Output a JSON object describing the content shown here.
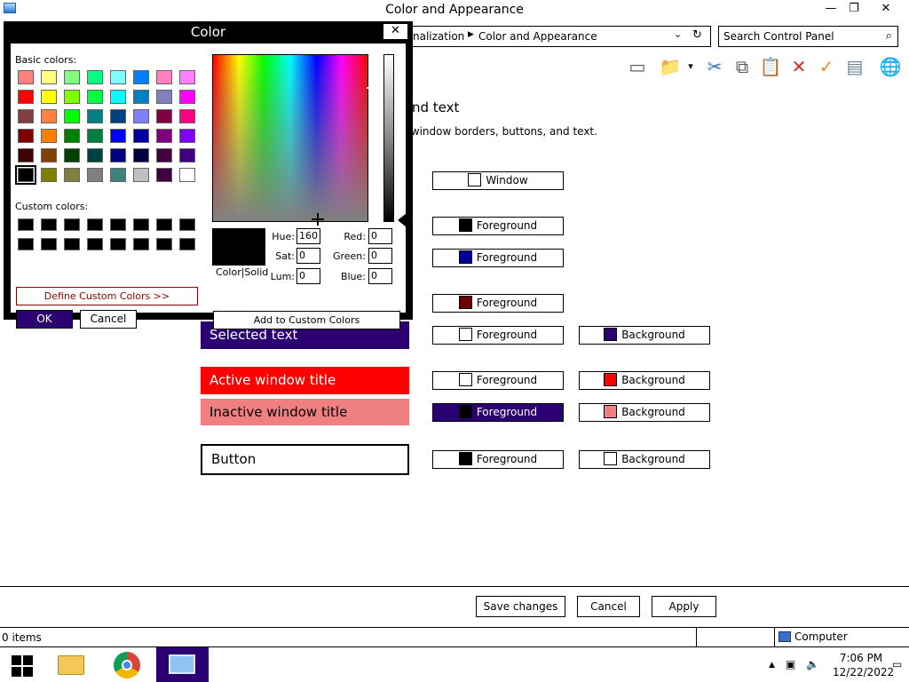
{
  "window": {
    "title": "Color and Appearance",
    "minimize": "—",
    "maximize": "❐",
    "close": "✕"
  },
  "address": {
    "crumb1": "nalization",
    "crumb2": "Color and Appearance",
    "sep": "▶",
    "dropdown": "⌄",
    "refresh": "↻"
  },
  "search": {
    "placeholder": "Search Control Panel",
    "icon": "⌕"
  },
  "toolbar": {
    "icons": [
      "panel-icon",
      "folder-check-icon",
      "dropdown-icon",
      "cut-icon",
      "copy-icon",
      "paste-icon",
      "delete-icon",
      "check-icon",
      "properties-icon",
      "globe-icon"
    ],
    "glyphs": [
      "▭",
      "📁",
      "▾",
      "✂",
      "⧉",
      "📋",
      "✕",
      "✓",
      "▤",
      "🌐"
    ],
    "colors": [
      "#555555",
      "#d4a017",
      "#000000",
      "#2f6fc0",
      "#555555",
      "#8a6d1f",
      "#d62b2b",
      "#f08c24",
      "#6a7f99",
      "#2e8bc0"
    ]
  },
  "heading": {
    "partial_title": "nd text",
    "partial_sub": "r window borders, buttons, and text."
  },
  "samples": {
    "selected": "Selected text",
    "active": "Active window title",
    "inactive": "Inactive window title",
    "button": "Button"
  },
  "colorbuttons": {
    "window_label": "Window",
    "fg1": "Foreground",
    "fg2": "Foreground",
    "fg3": "Foreground",
    "selected_fg": "Foreground",
    "selected_bg": "Background",
    "active_fg": "Foreground",
    "active_bg": "Background",
    "inactive_fg": "Foreground",
    "inactive_bg": "Background",
    "button_fg": "Foreground",
    "button_bg": "Background"
  },
  "colors": {
    "window": "#ffffff",
    "fg1": "#000000",
    "fg2": "#000099",
    "fg3": "#6b0000",
    "selected_fg": "#ffffff",
    "selected_bg": "#2b0071",
    "active_fg": "#ffffff",
    "active_bg": "#ff0000",
    "inactive_fg": "#000000",
    "inactive_bg": "#f08080",
    "button_fg": "#000000",
    "button_bg": "#ffffff",
    "accent": "#2b0071"
  },
  "bottom": {
    "save": "Save changes",
    "cancel": "Cancel",
    "apply": "Apply"
  },
  "status": {
    "items": "0 items",
    "computer": "Computer"
  },
  "taskbar": {
    "time": "7:06 PM",
    "date": "12/22/2022",
    "tray_up": "▲"
  },
  "dialog": {
    "title": "Color",
    "close": "✕",
    "basic_label": "Basic colors:",
    "custom_label": "Custom colors:",
    "define": "Define Custom Colors >>",
    "ok": "OK",
    "cancel": "Cancel",
    "color_solid": "Color|Solid",
    "hue_label": "Hue:",
    "sat_label": "Sat:",
    "lum_label": "Lum:",
    "red_label": "Red:",
    "green_label": "Green:",
    "blue_label": "Blue:",
    "hue": "160",
    "sat": "0",
    "lum": "0",
    "red": "0",
    "green": "0",
    "blue": "0",
    "add": "Add to Custom Colors",
    "basic_colors": [
      "#ff8080",
      "#ffff80",
      "#80ff80",
      "#00ff80",
      "#80ffff",
      "#0080ff",
      "#ff80c0",
      "#ff80ff",
      "#ff0000",
      "#ffff00",
      "#80ff00",
      "#00ff40",
      "#00ffff",
      "#0080c0",
      "#8080c0",
      "#ff00ff",
      "#804040",
      "#ff8040",
      "#00ff00",
      "#008080",
      "#004080",
      "#8080ff",
      "#800040",
      "#ff0080",
      "#800000",
      "#ff8000",
      "#008000",
      "#008040",
      "#0000ff",
      "#0000a0",
      "#800080",
      "#8000ff",
      "#400000",
      "#804000",
      "#004000",
      "#004040",
      "#000080",
      "#000040",
      "#400040",
      "#400080",
      "#000000",
      "#808000",
      "#808040",
      "#808080",
      "#408080",
      "#c0c0c0",
      "#400040",
      "#ffffff"
    ],
    "selected_index": 40
  }
}
